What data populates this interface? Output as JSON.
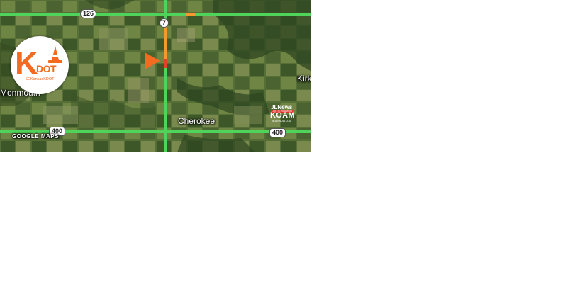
{
  "map": {
    "places": {
      "monmouth": "Monmouth",
      "cherokee": "Cherokee",
      "kirk": "Kirk"
    },
    "shields": {
      "us126": "126",
      "k7": "7",
      "us400_west": "400",
      "us400_east": "400"
    },
    "attribution": "GOOGLE MAPS",
    "traffic_colors": {
      "free_flow": "#4fd35a",
      "slow": "#f29b2c",
      "stopped": "#e4402b"
    }
  },
  "kdot_logo": {
    "letter": "K",
    "dot": "DOT",
    "handle": "SEKansasKDOT",
    "brand_color": "#f26b21"
  },
  "station_bug": {
    "jl": "JLNews",
    "live": "LIVE STREAMING",
    "name": "KOAM",
    "site": "NEWSNOW.COM"
  },
  "controls": {
    "play_icon": "play-icon",
    "play_color": "#f26b21"
  }
}
